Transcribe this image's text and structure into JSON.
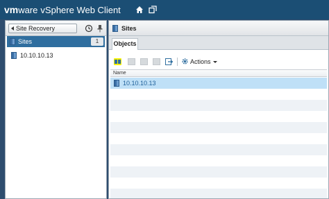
{
  "header": {
    "brand_vm": "vm",
    "brand_ware": "ware",
    "product": "vSphere Web Client",
    "icons": [
      "home-icon",
      "new-window-icon"
    ]
  },
  "navigator": {
    "back_label": "Site Recovery",
    "icons": [
      "history-icon",
      "pin-icon"
    ],
    "selected": {
      "label": "Sites",
      "count": "1"
    },
    "tree": [
      {
        "label": "10.10.10.13",
        "icon": "site-icon"
      }
    ]
  },
  "main": {
    "title": "Sites",
    "tabs": [
      {
        "label": "Objects"
      }
    ],
    "toolbar": {
      "actions_label": "Actions",
      "icons": [
        "pair-site-icon",
        "disabled-action-icon",
        "disabled-action-icon",
        "disabled-action-icon",
        "export-icon",
        "gear-icon"
      ]
    },
    "grid": {
      "columns": [
        "Name"
      ],
      "rows": [
        {
          "name": "10.10.10.13"
        }
      ]
    }
  },
  "colors": {
    "header_bg": "#1b4e74",
    "selection_bg": "#2f6e9f",
    "row_selected_bg": "#bfe0f7",
    "highlight": "#f7f100"
  }
}
